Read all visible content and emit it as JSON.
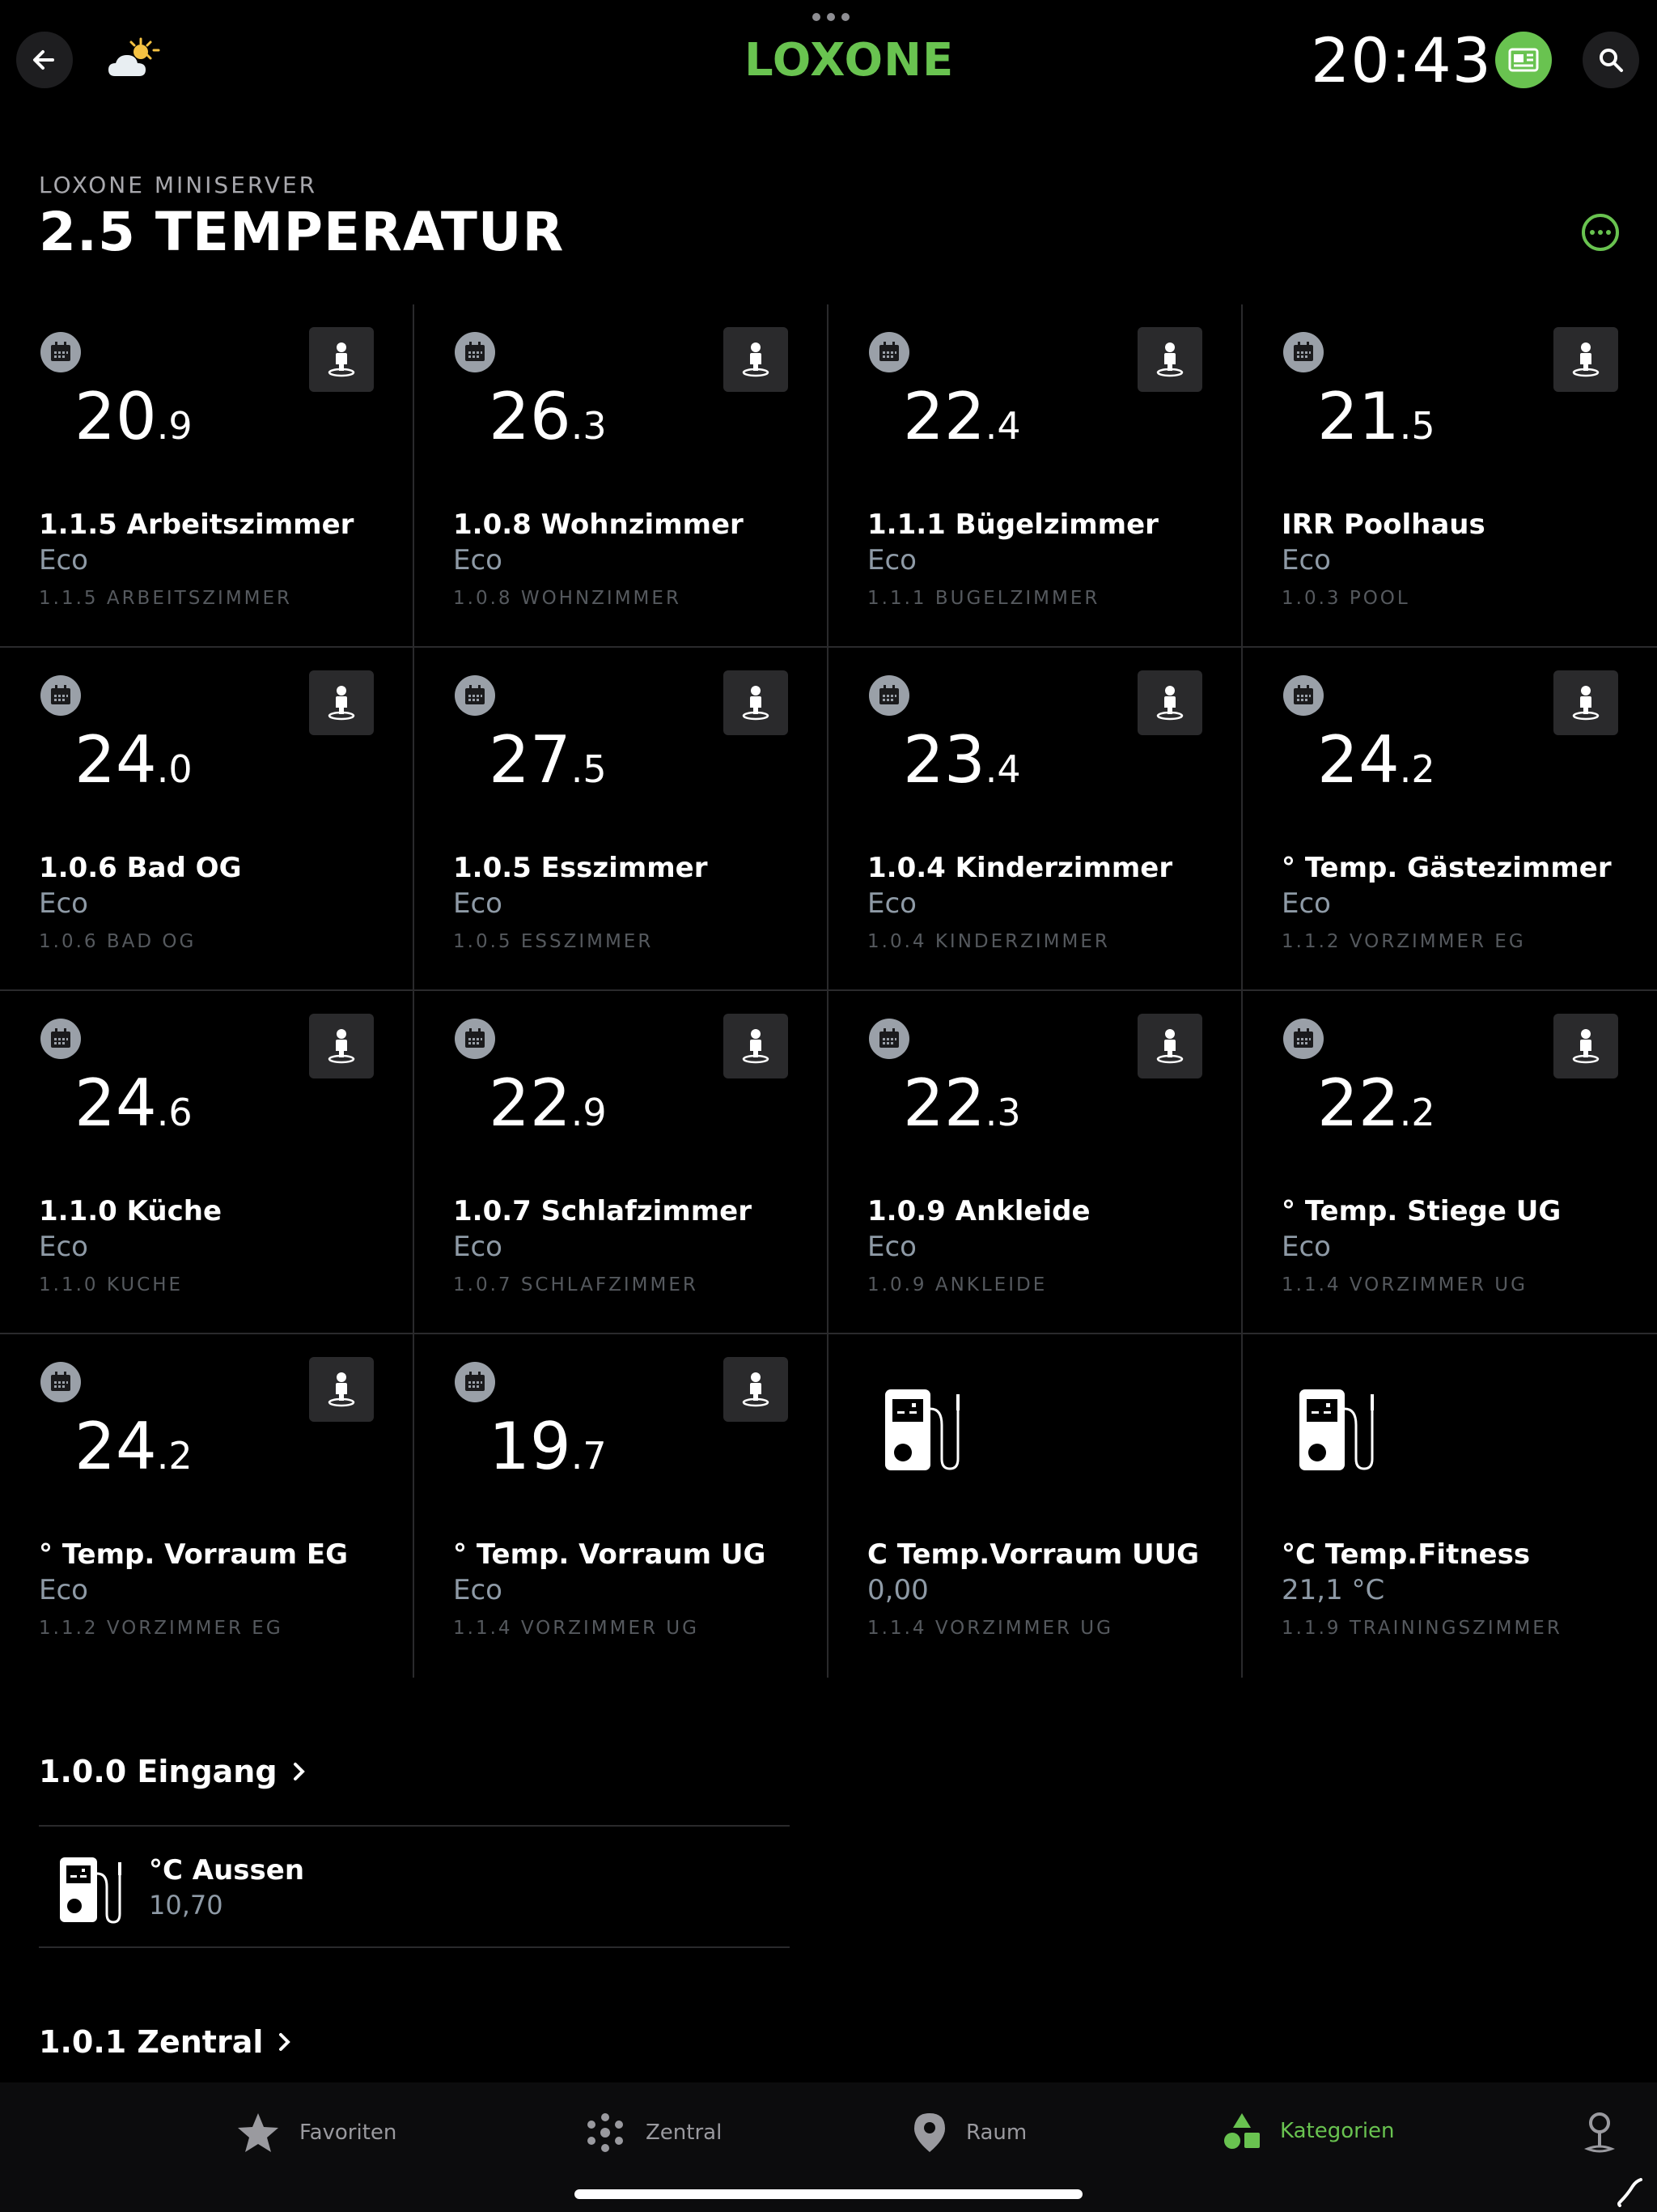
{
  "header": {
    "logo": "LOXONE",
    "time": "20:43",
    "icons": [
      "back-arrow-icon",
      "weather-icon",
      "news-icon",
      "search-icon"
    ]
  },
  "page": {
    "subtitle": "LOXONE MINISERVER",
    "title": "2.5 TEMPERATUR"
  },
  "tiles": [
    {
      "int": "20",
      "dec": ".9",
      "name": "1.1.5 Arbeitszimmer",
      "state": "Eco",
      "room": "1.1.5 ARBEITSZIMMER"
    },
    {
      "int": "26",
      "dec": ".3",
      "name": "1.0.8 Wohnzimmer",
      "state": "Eco",
      "room": "1.0.8 WOHNZIMMER"
    },
    {
      "int": "22",
      "dec": ".4",
      "name": "1.1.1 Bügelzimmer",
      "state": "Eco",
      "room": "1.1.1 BUGELZIMMER"
    },
    {
      "int": "21",
      "dec": ".5",
      "name": "IRR Poolhaus",
      "state": "Eco",
      "room": "1.0.3 POOL"
    },
    {
      "int": "24",
      "dec": ".0",
      "name": "1.0.6 Bad OG",
      "state": "Eco",
      "room": "1.0.6 BAD OG"
    },
    {
      "int": "27",
      "dec": ".5",
      "name": "1.0.5 Esszimmer",
      "state": "Eco",
      "room": "1.0.5 ESSZIMMER"
    },
    {
      "int": "23",
      "dec": ".4",
      "name": "1.0.4 Kinderzimmer",
      "state": "Eco",
      "room": "1.0.4 KINDERZIMMER"
    },
    {
      "int": "24",
      "dec": ".2",
      "name": "° Temp. Gästezimmer",
      "state": "Eco",
      "room": "1.1.2 VORZIMMER EG"
    },
    {
      "int": "24",
      "dec": ".6",
      "name": "1.1.0 Küche",
      "state": "Eco",
      "room": "1.1.0 KUCHE"
    },
    {
      "int": "22",
      "dec": ".9",
      "name": "1.0.7 Schlafzimmer",
      "state": "Eco",
      "room": "1.0.7 SCHLAFZIMMER"
    },
    {
      "int": "22",
      "dec": ".3",
      "name": "1.0.9 Ankleide",
      "state": "Eco",
      "room": "1.0.9 ANKLEIDE"
    },
    {
      "int": "22",
      "dec": ".2",
      "name": "° Temp. Stiege UG",
      "state": "Eco",
      "room": "1.1.4 VORZIMMER UG"
    },
    {
      "int": "24",
      "dec": ".2",
      "name": "° Temp. Vorraum EG",
      "state": "Eco",
      "room": "1.1.2 VORZIMMER EG"
    },
    {
      "int": "19",
      "dec": ".7",
      "name": "° Temp. Vorraum UG",
      "state": "Eco",
      "room": "1.1.4 VORZIMMER UG"
    },
    {
      "name": "C Temp.Vorraum UUG",
      "state": "0,00",
      "room": "1.1.4 VORZIMMER UG"
    },
    {
      "name": "°C Temp.Fitness",
      "state": "21,1 °C",
      "room": "1.1.9 TRAININGSZIMMER"
    }
  ],
  "sections": [
    {
      "label": "1.0.0 Eingang"
    },
    {
      "label": "1.0.1 Zentral"
    }
  ],
  "list": [
    {
      "name": "°C Aussen",
      "value": "10,70"
    }
  ],
  "nav": {
    "favoriten": "Favoriten",
    "zentral": "Zentral",
    "raum": "Raum",
    "kategorien": "Kategorien"
  },
  "colors": {
    "accent": "#69c350",
    "background": "#000000",
    "secondary_text": "#8e9aa6"
  }
}
